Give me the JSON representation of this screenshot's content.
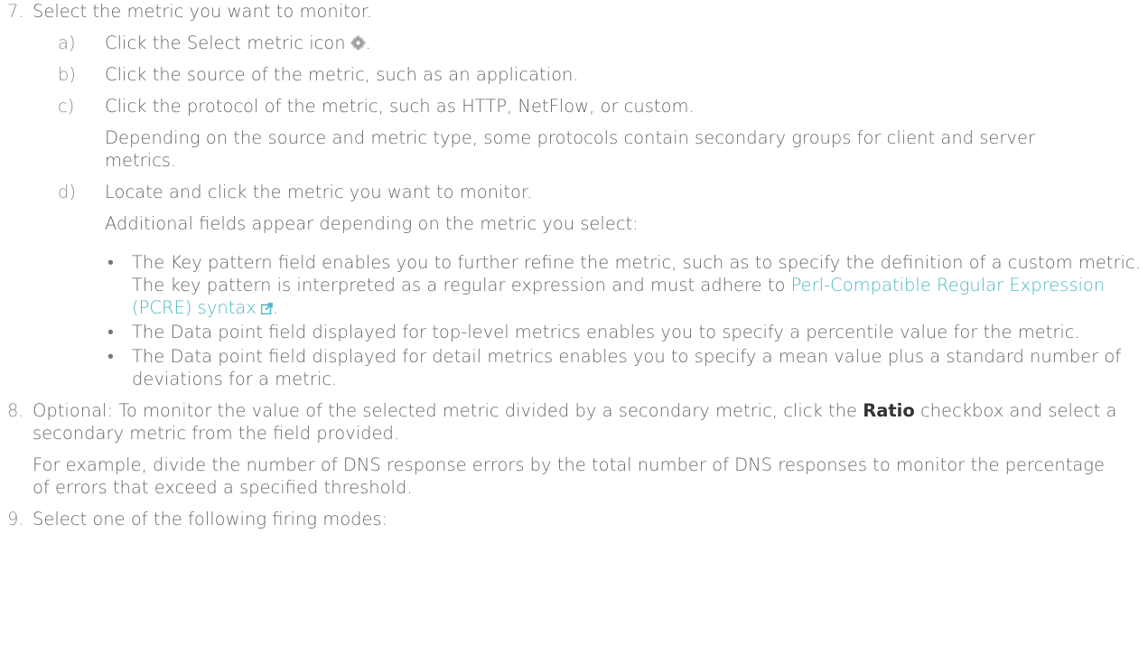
{
  "steps": {
    "s7": {
      "num": "7.",
      "text": "Select the metric you want to monitor.",
      "a": {
        "letter": "a)",
        "text": "Click the Select metric icon",
        "after": "."
      },
      "b": {
        "letter": "b)",
        "text": "Click the source of the metric, such as an application."
      },
      "c": {
        "letter": "c)",
        "text": "Click the protocol of the metric, such as HTTP, NetFlow, or custom.",
        "note": "Depending on the source and metric type, some protocols contain secondary groups for client and server metrics."
      },
      "d": {
        "letter": "d)",
        "text": "Locate and click the metric you want to monitor.",
        "note": "Additional fields appear depending on the metric you select:",
        "bullets": [
          {
            "text": "The Key pattern field enables you to further refine the metric, such as to specify the definition of a custom metric. The key pattern is interpreted as a regular expression and must adhere to ",
            "link": "Perl-Compatible Regular Expression (PCRE) syntax",
            "after": "."
          },
          {
            "text": "The Data point field displayed for top-level metrics enables you to specify a percentile value for the metric."
          },
          {
            "text": "The Data point field displayed for detail metrics enables you to specify a mean value plus a standard number of deviations for a metric."
          }
        ]
      }
    },
    "s8": {
      "num": "8.",
      "text_before": "Optional: To monitor the value of the selected metric divided by a secondary metric, click the ",
      "bold": "Ratio",
      "text_after": " checkbox and select a secondary metric from the field provided.",
      "note": "For example, divide the number of DNS response errors by the total number of DNS responses to monitor the percentage of errors that exceed a specified threshold."
    },
    "s9": {
      "num": "9.",
      "text": "Select one of the following firing modes:"
    }
  },
  "icons": {
    "select_metric": "gear-icon",
    "external_link": "external-link-icon"
  },
  "colors": {
    "text": "#666666",
    "link": "#4db6c4",
    "bold": "#333333"
  }
}
